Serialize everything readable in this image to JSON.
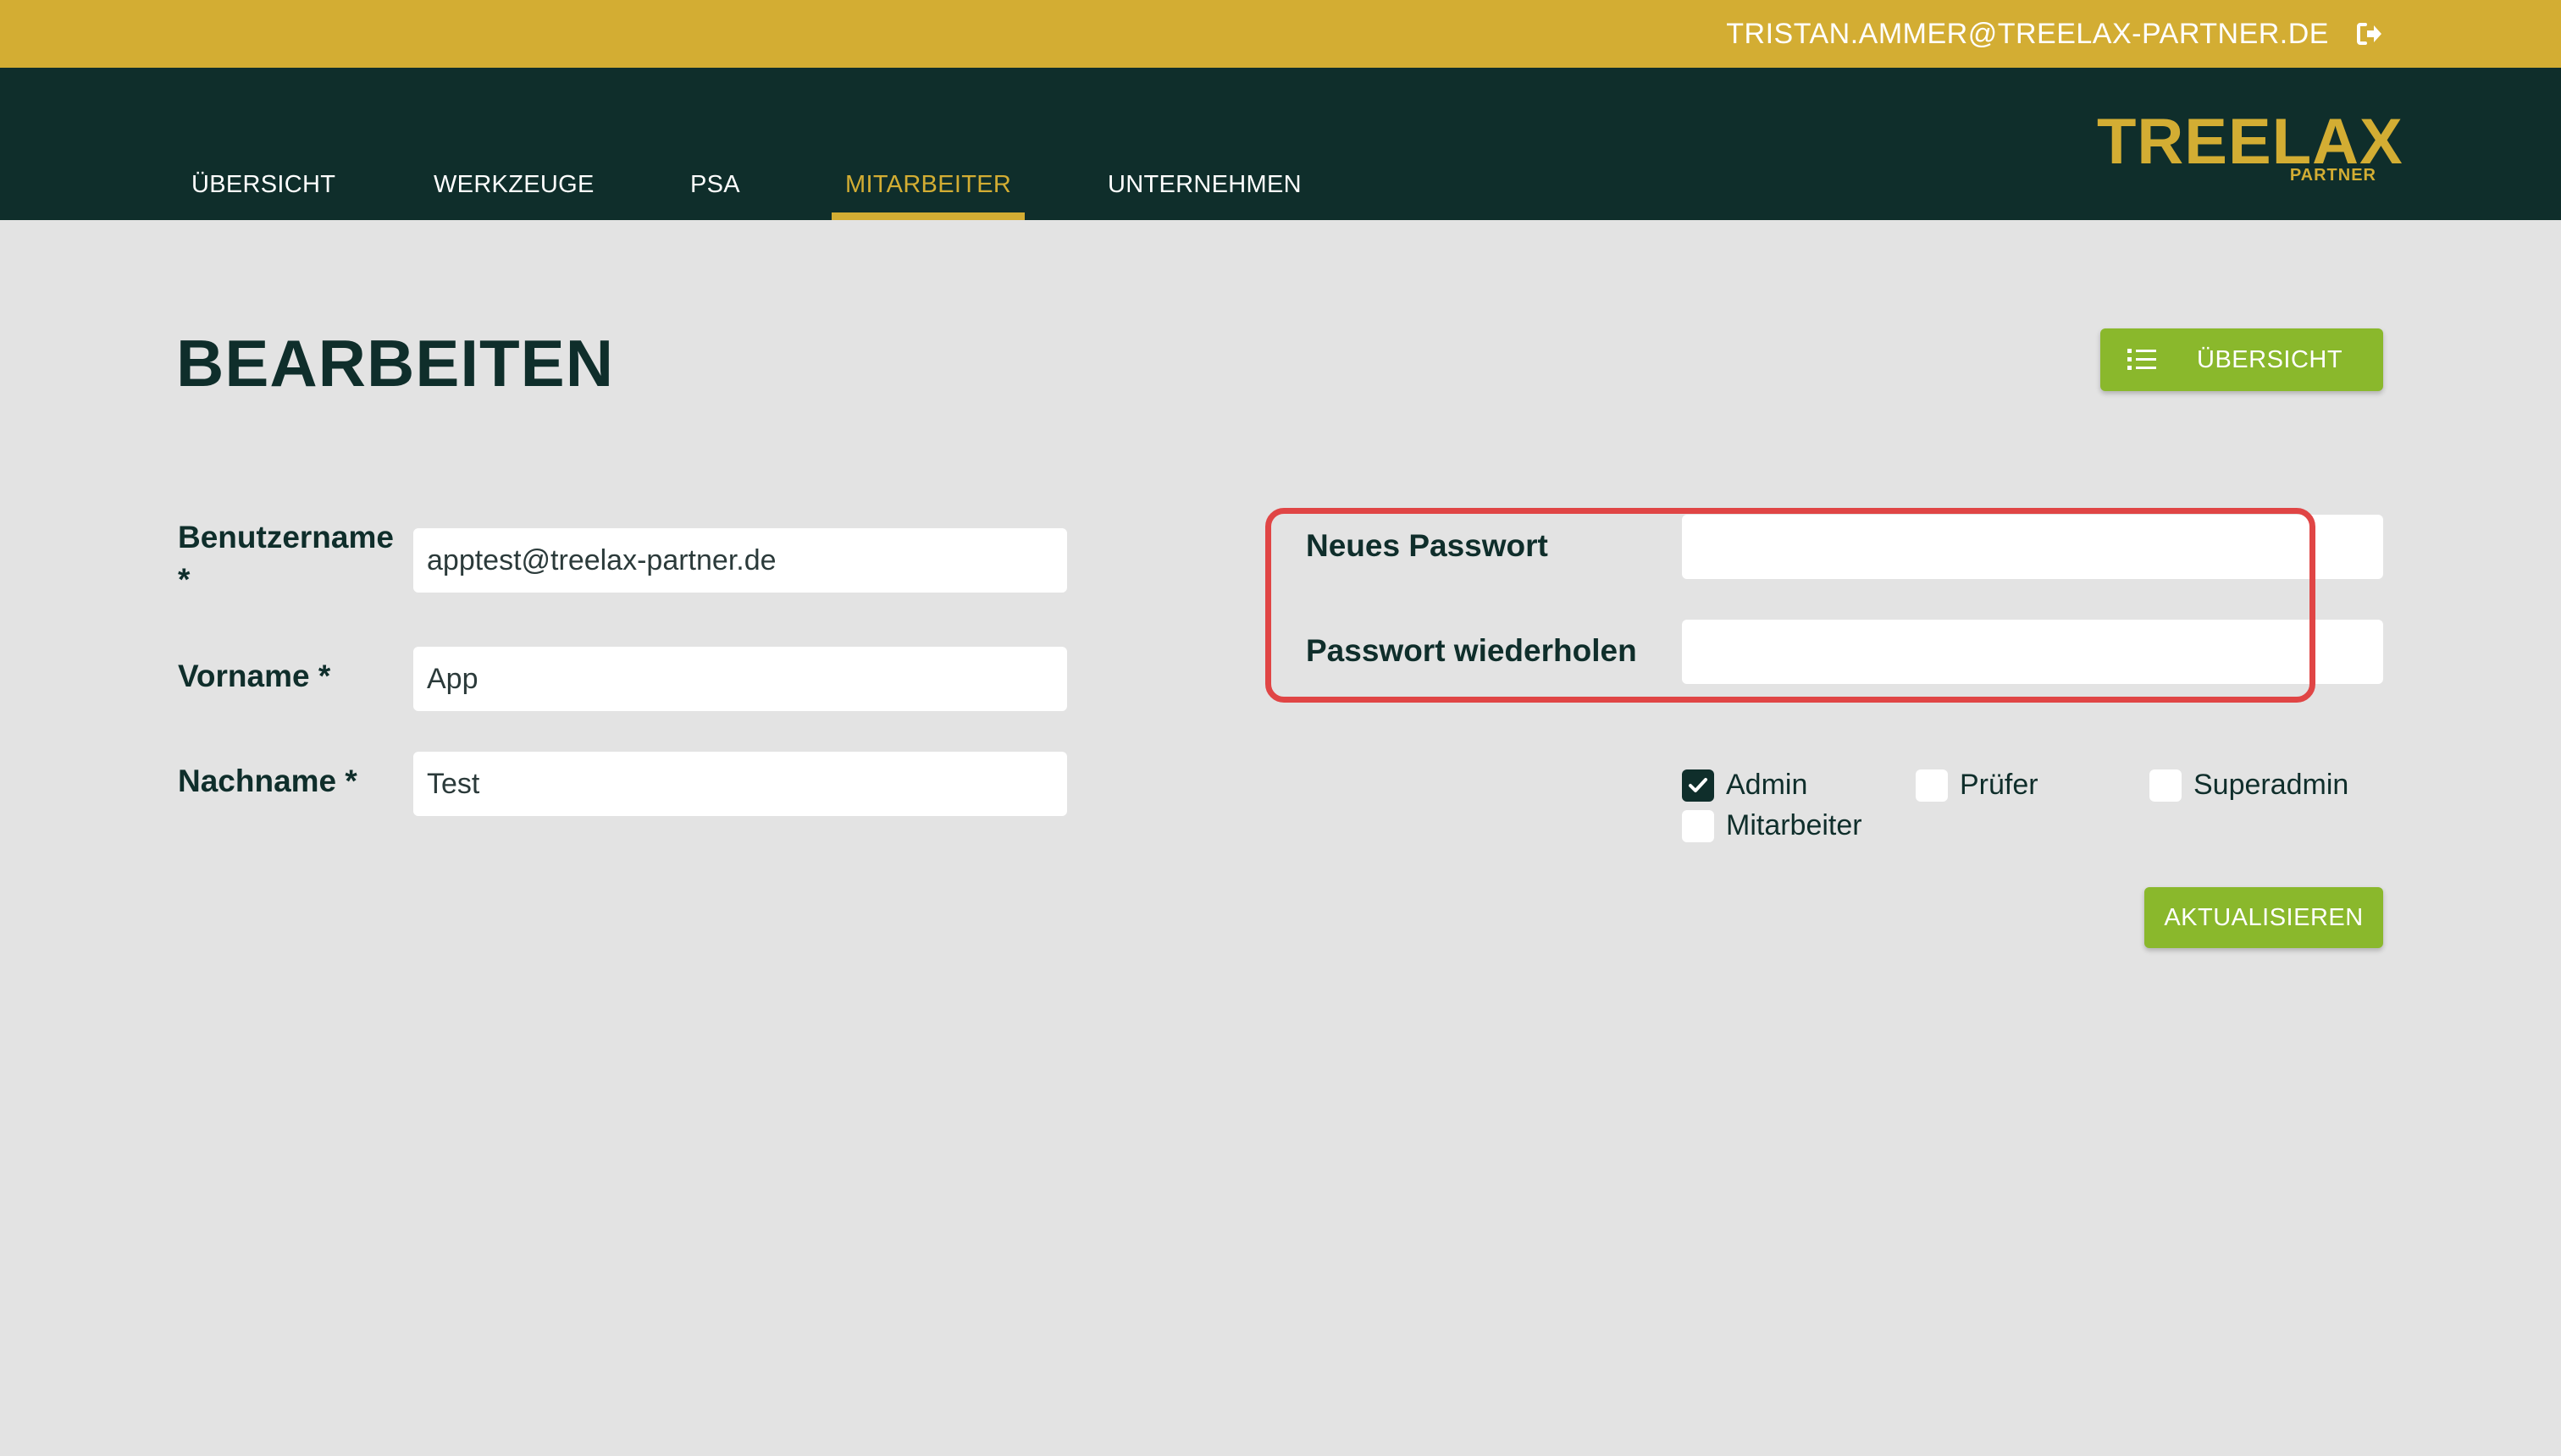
{
  "topbar": {
    "user_email": "TRISTAN.AMMER@TREELAX-PARTNER.DE",
    "logout_icon": "logout-icon",
    "background": "#d3ad33"
  },
  "nav": {
    "items": [
      {
        "label": "ÜBERSICHT"
      },
      {
        "label": "WERKZEUGE"
      },
      {
        "label": "PSA"
      },
      {
        "label": "MITARBEITER",
        "active": true
      },
      {
        "label": "UNTERNEHMEN"
      }
    ],
    "background": "#0f2e2b",
    "accent": "#d3ad33"
  },
  "logo": {
    "main": "TREELAX",
    "sub": "PARTNER"
  },
  "page": {
    "title": "BEARBEITEN",
    "overview_button": {
      "label": "ÜBERSICHT",
      "icon": "list-icon"
    },
    "update_button": {
      "label": "AKTUALISIEREN"
    },
    "button_color": "#8ab82c"
  },
  "form": {
    "username": {
      "label": "Benutzername",
      "required_mark": "*",
      "value": "apptest@treelax-partner.de"
    },
    "firstname": {
      "label": "Vorname *",
      "value": "App"
    },
    "lastname": {
      "label": "Nachname *",
      "value": "Test"
    },
    "new_password": {
      "label": "Neues Passwort",
      "value": ""
    },
    "repeat_password": {
      "label": "Passwort wiederholen",
      "value": ""
    },
    "highlight_color": "#e04545"
  },
  "roles": [
    {
      "label": "Admin",
      "checked": true
    },
    {
      "label": "Prüfer",
      "checked": false
    },
    {
      "label": "Superadmin",
      "checked": false
    },
    {
      "label": "Mitarbeiter",
      "checked": false
    }
  ]
}
